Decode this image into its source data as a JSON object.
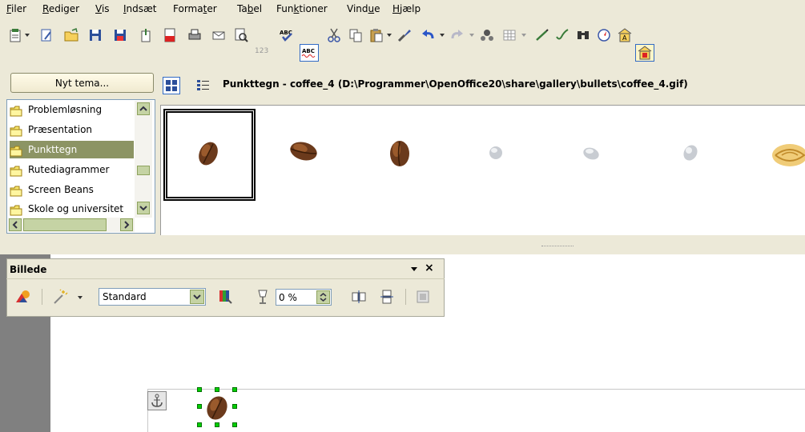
{
  "menu": {
    "items": [
      {
        "prefix": "",
        "mnemonic": "F",
        "rest": "iler"
      },
      {
        "prefix": "",
        "mnemonic": "R",
        "rest": "ediger"
      },
      {
        "prefix": "",
        "mnemonic": "V",
        "rest": "is"
      },
      {
        "prefix": "",
        "mnemonic": "I",
        "rest": "ndsæt"
      },
      {
        "prefix": "Forma",
        "mnemonic": "t",
        "rest": "er"
      },
      {
        "prefix": "Ta",
        "mnemonic": "b",
        "rest": "el"
      },
      {
        "prefix": "Fun",
        "mnemonic": "k",
        "rest": "tioner"
      },
      {
        "prefix": "Vind",
        "mnemonic": "u",
        "rest": "e"
      },
      {
        "prefix": "",
        "mnemonic": "H",
        "rest": "jælp"
      }
    ]
  },
  "toolbar": {
    "icons": [
      "templates-icon",
      "new-document-icon",
      "open-folder-icon",
      "save-icon",
      "save-as-icon",
      "edit-file-icon",
      "export-pdf-icon",
      "print-icon",
      "email-icon",
      "page-preview-icon",
      "autotext-123-icon",
      "spellcheck-icon",
      "auto-spellcheck-icon",
      "cut-icon",
      "copy-icon",
      "paste-icon",
      "format-paintbrush-icon",
      "undo-icon",
      "redo-icon",
      "navigator-icon",
      "table-icon",
      "draw-functions-icon",
      "hyperlink-icon",
      "find-replace-icon",
      "compass-icon",
      "font-icon",
      "gallery-icon"
    ],
    "autotext_label": "123",
    "spell_label": "ABC"
  },
  "gallery": {
    "new_theme_label": "Nyt tema...",
    "path_title": "Punkttegn - coffee_4 (D:\\Programmer\\OpenOffice20\\share\\gallery\\bullets\\coffee_4.gif)",
    "themes": [
      {
        "label": "Problemløsning",
        "selected": false
      },
      {
        "label": "Præsentation",
        "selected": false
      },
      {
        "label": "Punkttegn",
        "selected": true
      },
      {
        "label": "Rutediagrammer",
        "selected": false
      },
      {
        "label": "Screen Beans",
        "selected": false
      },
      {
        "label": "Skole og universitet",
        "selected": false
      }
    ],
    "thumbnails": [
      "coffee-bean-1",
      "coffee-bean-2",
      "coffee-bean-3",
      "white-stone-1",
      "white-stone-2",
      "white-stone-3",
      "gold-swirl"
    ],
    "selected_thumbnail": "coffee-bean-1"
  },
  "picture_toolbar": {
    "title": "Billede",
    "close_label": "×",
    "graphics_mode": "Standard",
    "transparency": "0 %"
  },
  "colors": {
    "selection": "#8c9464",
    "face": "#ece9d8",
    "handle": "#00d000"
  }
}
